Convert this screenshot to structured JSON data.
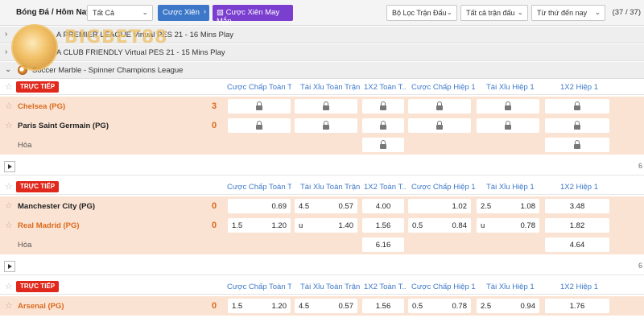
{
  "toolbar": {
    "title": "Bóng Đá / Hôm Nay",
    "filter_all": "Tất Cả",
    "parlay_button": "Cược Xiên",
    "lucky_parlay_button": "Cược Xiên May Mắn",
    "match_filter": "Bộ Lọc Trận Đấu",
    "all_matches": "Tất cả trận đấu",
    "sort": "Từ thứ đến nay",
    "counter": "(37 / 37)"
  },
  "watermark": {
    "brand": "BIGBET88"
  },
  "leagues": [
    {
      "name": "A PREMIER LEAGUE Virtual PES 21 - 16 Mins Play"
    },
    {
      "name": "A CLUB FRIENDLY Virtual PES 21 - 15 Mins Play"
    },
    {
      "name": "Soccer Marble - Spinner Champions League"
    }
  ],
  "columns": [
    "Cược Chấp Toàn T...",
    "Tài Xỉu Toàn Trận",
    "1X2 Toàn T...",
    "Cược Chấp Hiệp 1",
    "Tài Xỉu Hiệp 1",
    "1X2 Hiệp 1"
  ],
  "live_label": "TRỰC TIẾP",
  "draw_label": "Hòa",
  "more_label": "6",
  "matches": [
    {
      "home": {
        "name": "Chelsea (PG)",
        "score": "3"
      },
      "away": {
        "name": "Paris Saint Germain (PG)",
        "score": "0"
      }
    },
    {
      "home": {
        "name": "Manchester City (PG)",
        "score": "0",
        "ah_ft": "0.69",
        "ou_ft_line": "4.5",
        "ou_ft": "0.57",
        "x_ft": "4.00",
        "ah_h1": "1.02",
        "ou_h1_line": "2.5",
        "ou_h1": "1.08",
        "x_h1": "3.48"
      },
      "away": {
        "name": "Real Madrid (PG)",
        "score": "0",
        "ah_ft_line": "1.5",
        "ah_ft": "1.20",
        "ou_ft_line": "u",
        "ou_ft": "1.40",
        "x_ft": "1.56",
        "ah_h1_line": "0.5",
        "ah_h1": "0.84",
        "ou_h1_line": "u",
        "ou_h1": "0.78",
        "x_h1": "1.82"
      },
      "draw": {
        "x_ft": "6.16",
        "x_h1": "4.64"
      }
    },
    {
      "home": {
        "name": "Arsenal (PG)",
        "score": "0",
        "ah_ft_line": "1.5",
        "ah_ft": "1.20",
        "ou_ft_line": "4.5",
        "ou_ft": "0.57",
        "x_ft": "1.56",
        "ah_h1_line": "0.5",
        "ah_h1": "0.78",
        "ou_h1_line": "2.5",
        "ou_h1": "0.94",
        "x_h1": "1.76"
      }
    }
  ]
}
